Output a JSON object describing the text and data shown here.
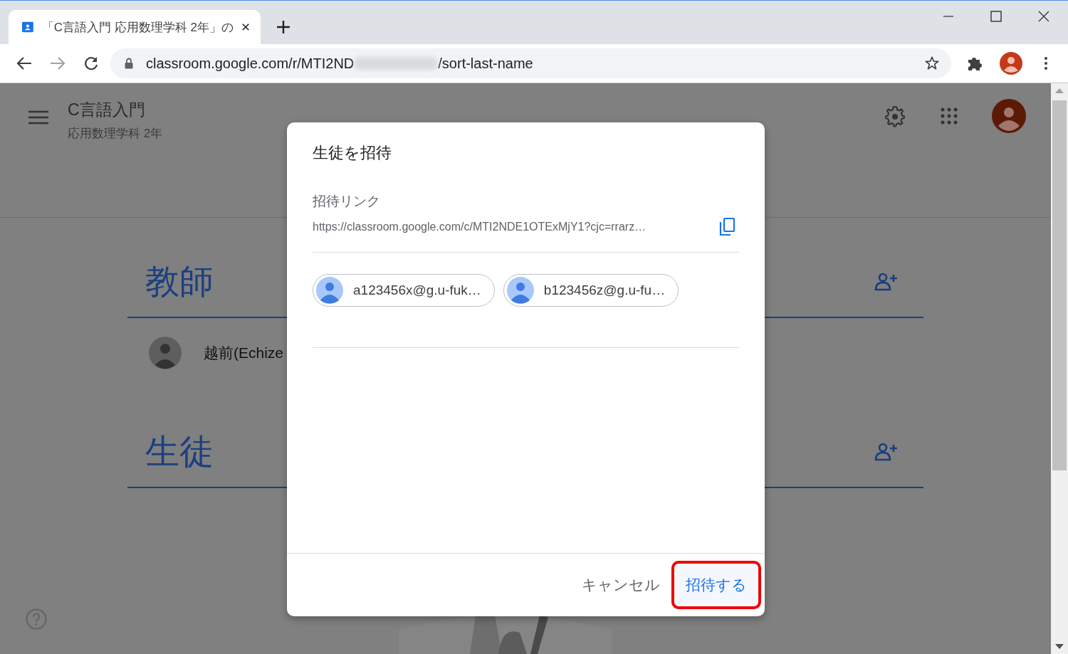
{
  "browser": {
    "tab": {
      "title": "「C言語入門 応用数理学科 2年」の"
    },
    "address": {
      "url_start": "classroom.google.com/r/MTI2ND",
      "url_end": "/sort-last-name"
    }
  },
  "class": {
    "name": "C言語入門",
    "section": "応用数理学科 2年"
  },
  "sections": [
    {
      "heading": "教師",
      "members": [
        {
          "name": "越前(Echize"
        }
      ]
    },
    {
      "heading": "生徒"
    }
  ],
  "dialog": {
    "title": "生徒を招待",
    "link_label": "招待リンク",
    "link": "https://classroom.google.com/c/MTI2NDE1OTExMjY1?cjc=rrarz…",
    "chips": [
      {
        "email": "a123456x@g.u-fuk…"
      },
      {
        "email": "b123456z@g.u-fu…"
      }
    ],
    "buttons": [
      {
        "label": "キャンセル",
        "kind": "text",
        "highlighted": false
      },
      {
        "label": "招待する",
        "kind": "primary",
        "highlighted": true
      }
    ]
  }
}
